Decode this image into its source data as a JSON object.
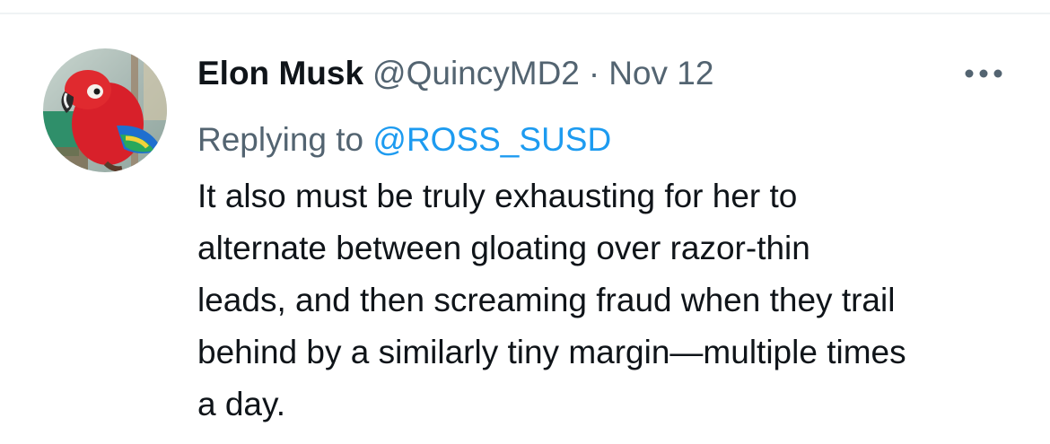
{
  "tweet": {
    "author": {
      "display_name": "Elon Musk",
      "handle": "@QuincyMD2",
      "avatar_icon": "parrot-avatar-icon"
    },
    "separator": "·",
    "timestamp": "Nov 12",
    "replying_prefix": "Replying to",
    "replying_to": "@ROSS_SUSD",
    "text_lines": [
      "It also must be truly exhausting for her to",
      "alternate between gloating over razor-thin",
      "leads, and then screaming fraud when they trail",
      "behind by a similarly tiny margin—multiple times",
      "a day."
    ],
    "more_icon": "more-dots-icon"
  },
  "colors": {
    "text_primary": "#0f1419",
    "text_secondary": "#536471",
    "link": "#1d9bf0",
    "divider": "#eff3f4"
  }
}
